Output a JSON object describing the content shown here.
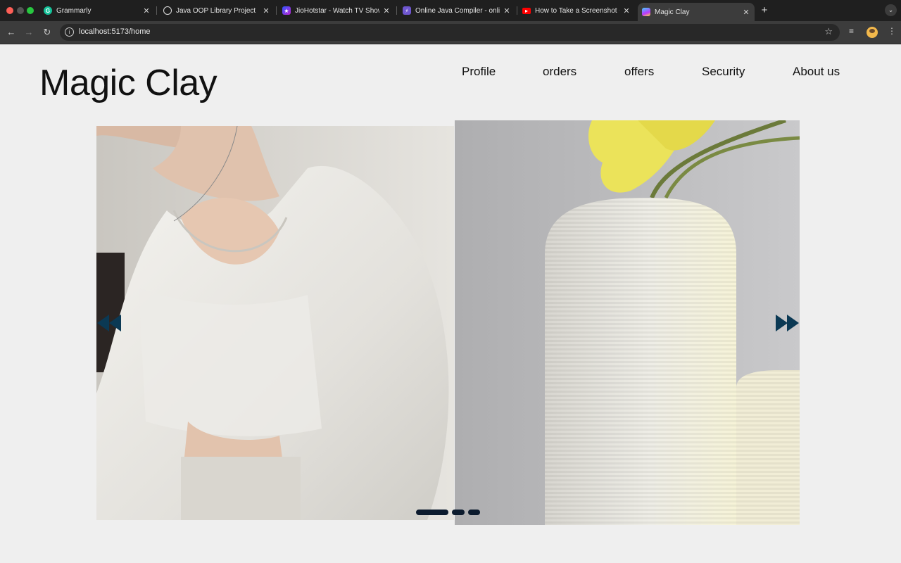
{
  "browser": {
    "tabs": [
      {
        "title": "Grammarly",
        "favicon": "grammarly-icon",
        "color": "#15c39a"
      },
      {
        "title": "Java OOP Library Project",
        "favicon": "openai-icon",
        "color": "#e0e0e0"
      },
      {
        "title": "JioHotstar - Watch TV Shows",
        "favicon": "jiohotstar-icon",
        "color": "#6b2fd6"
      },
      {
        "title": "Online Java Compiler - online",
        "favicon": "bolt-icon",
        "color": "#6e56cf"
      },
      {
        "title": "How to Take a Screenshot On",
        "favicon": "youtube-icon",
        "color": "#ff0000"
      },
      {
        "title": "Magic Clay",
        "favicon": "vite-icon",
        "color": "#a855f7"
      }
    ],
    "active_tab": 5,
    "url": "localhost:5173/home"
  },
  "header": {
    "brand": "Magic Clay",
    "nav": [
      "Profile",
      "orders",
      "offers",
      "Security",
      "About us"
    ]
  },
  "carousel": {
    "slides": [
      "woman-white-blouse-photo",
      "white-ribbed-vase-photo"
    ],
    "arrow_color": "#0b3954",
    "dot_color": "#0c1b2e",
    "dots": 3,
    "active_dot": 0
  }
}
